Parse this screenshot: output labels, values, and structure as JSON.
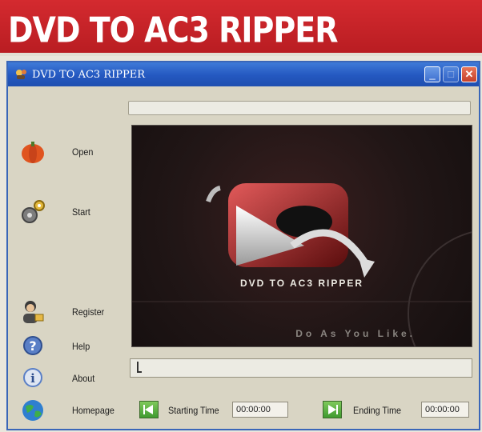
{
  "banner": {
    "title": "DVD TO AC3 RIPPER"
  },
  "window": {
    "title": "DVD TO AC3 RIPPER",
    "controls": [
      "minimize",
      "maximize",
      "close"
    ]
  },
  "sidebar": {
    "items": [
      {
        "label": "Open",
        "icon": "pumpkin-icon"
      },
      {
        "label": "Start",
        "icon": "gears-icon"
      },
      {
        "label": "Register",
        "icon": "register-person-icon"
      },
      {
        "label": "Help",
        "icon": "help-icon"
      },
      {
        "label": "About",
        "icon": "info-icon"
      },
      {
        "label": "Homepage",
        "icon": "globe-icon"
      }
    ]
  },
  "preview": {
    "logo_text": "DVD TO AC3 RIPPER",
    "slogan": "Do As You Like."
  },
  "seek": {
    "position": 0.0
  },
  "bottom": {
    "starting_time_label": "Starting Time",
    "starting_time_value": "00:00:00",
    "ending_time_label": "Ending Time",
    "ending_time_value": "00:00:00"
  },
  "colors": {
    "banner_red": "#c8242a",
    "titlebar_blue": "#2458c0",
    "window_bg": "#d9d5c4",
    "preview_bg": "#211616"
  }
}
